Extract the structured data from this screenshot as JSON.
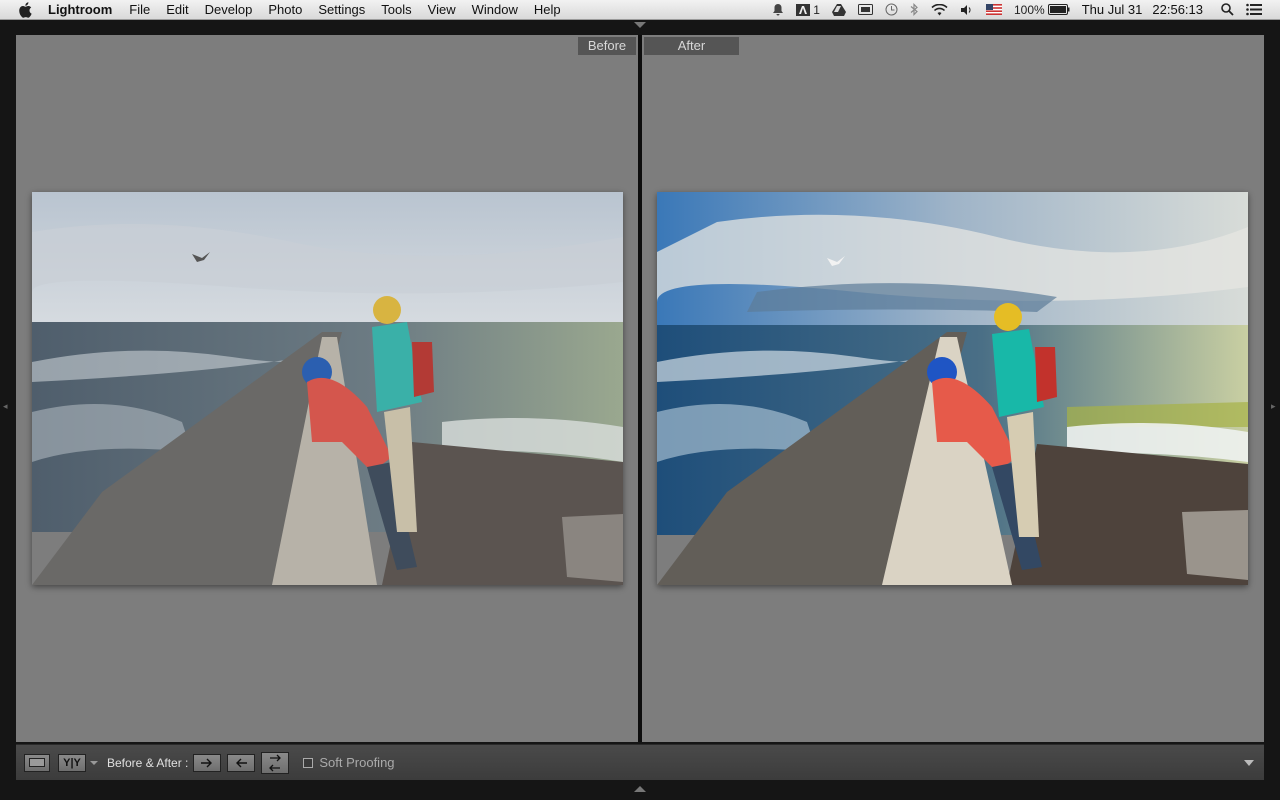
{
  "menubar": {
    "app_name": "Lightroom",
    "menus": [
      "File",
      "Edit",
      "Develop",
      "Photo",
      "Settings",
      "Tools",
      "View",
      "Window",
      "Help"
    ],
    "status": {
      "adobe_count": "1",
      "battery": "100%",
      "date": "Thu Jul 31",
      "time": "22:56:13"
    },
    "icons": [
      "apple-icon",
      "notification-icon",
      "adobe-icon",
      "drive-icon",
      "display-icon",
      "time-machine-icon",
      "bluetooth-icon",
      "wifi-icon",
      "volume-icon",
      "flag-icon",
      "battery-icon",
      "spotlight-icon",
      "list-icon"
    ]
  },
  "view": {
    "before_label": "Before",
    "after_label": "After"
  },
  "toolbar": {
    "yy_label": "Y|Y",
    "before_after_label": "Before & After :",
    "soft_proofing_label": "Soft Proofing",
    "soft_proofing_checked": false
  },
  "colors": {
    "pane_bg": "#7d7d7d",
    "frame_bg": "#151515",
    "toolbar_bg": "#424242"
  }
}
